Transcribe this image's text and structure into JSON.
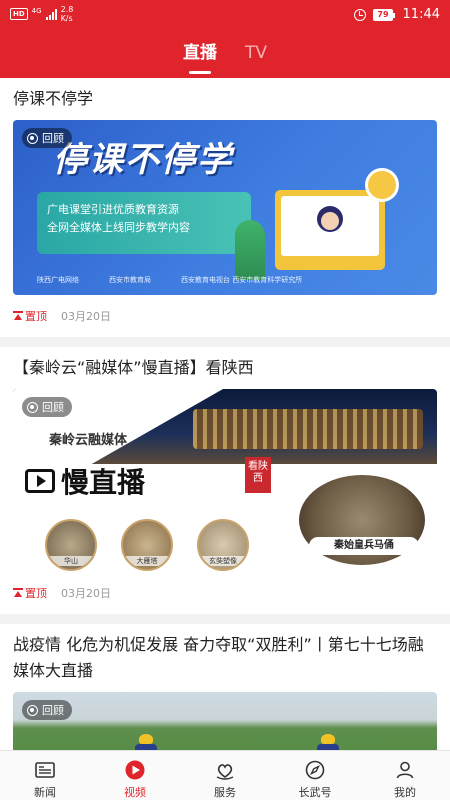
{
  "status_bar": {
    "hd": "HD",
    "signal": "4G",
    "net_speed_value": "2.8",
    "net_speed_unit": "K/s",
    "battery": "79",
    "time": "11:44"
  },
  "tabs": [
    {
      "label": "直播",
      "active": true
    },
    {
      "label": "TV",
      "active": false
    }
  ],
  "feed": [
    {
      "title": "停课不停学",
      "badge": "回顾",
      "thumb": {
        "headline": "停课不停学",
        "banner_line1": "广电课堂引进优质教育资源",
        "banner_line2": "全网全媒体上线同步教学内容",
        "logo1": "陕西广电网络",
        "logo2": "西安市教育局",
        "logo3": "西安教育电视台 西安市教育科学研究所"
      },
      "pin_label": "置顶",
      "date": "03月20日"
    },
    {
      "title": "【秦岭云“融媒体”慢直播】看陕西",
      "badge": "回顾",
      "thumb": {
        "top_text": "秦岭云融媒体",
        "main_text": "慢直播",
        "stamp": "看陕西",
        "circle_labels": [
          "华山",
          "大雁塔",
          "玄奘塑像"
        ],
        "big_label": "秦始皇兵马俑"
      },
      "pin_label": "置顶",
      "date": "03月20日"
    },
    {
      "title": "战疫情 化危为机促发展 奋力夺取“双胜利”丨第七十七场融媒体大直播",
      "badge": "回顾"
    }
  ],
  "tabbar": [
    {
      "label": "新闻",
      "icon": "news-icon",
      "active": false
    },
    {
      "label": "视频",
      "icon": "video-icon",
      "active": true
    },
    {
      "label": "服务",
      "icon": "service-icon",
      "active": false
    },
    {
      "label": "长武号",
      "icon": "compass-icon",
      "active": false
    },
    {
      "label": "我的",
      "icon": "profile-icon",
      "active": false
    }
  ],
  "colors": {
    "brand_red": "#e0242c",
    "date_gray": "#999999"
  }
}
